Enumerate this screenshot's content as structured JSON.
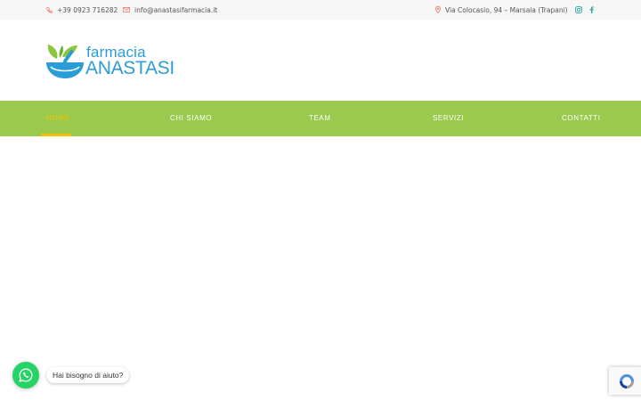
{
  "topbar": {
    "phone": "+39 0923 716282",
    "email": "info@anastasifarmacia.it",
    "address": "Via Colocasio, 94 – Marsala (Trapani)",
    "icons": [
      "phone-icon",
      "mail-icon",
      "location-pin-icon",
      "instagram-icon",
      "facebook-icon"
    ]
  },
  "logo": {
    "line1": "farmacia",
    "line2": "ANASTASI"
  },
  "nav": {
    "items": [
      {
        "label": "HOME",
        "active": true
      },
      {
        "label": "CHI SIAMO",
        "active": false
      },
      {
        "label": "TEAM",
        "active": false
      },
      {
        "label": "SERVIZI",
        "active": false
      },
      {
        "label": "CONTATTI",
        "active": false
      }
    ]
  },
  "whatsapp": {
    "prompt": "Hai bisogno di aiuto?",
    "icon": "whatsapp-icon"
  },
  "colors": {
    "nav_bg": "#9bc94e",
    "active": "#f6c000",
    "brand_blue": "#2b9dd6",
    "brand_green": "#8cc63f",
    "whatsapp": "#25d366",
    "icon_accent": "#e8735a"
  }
}
